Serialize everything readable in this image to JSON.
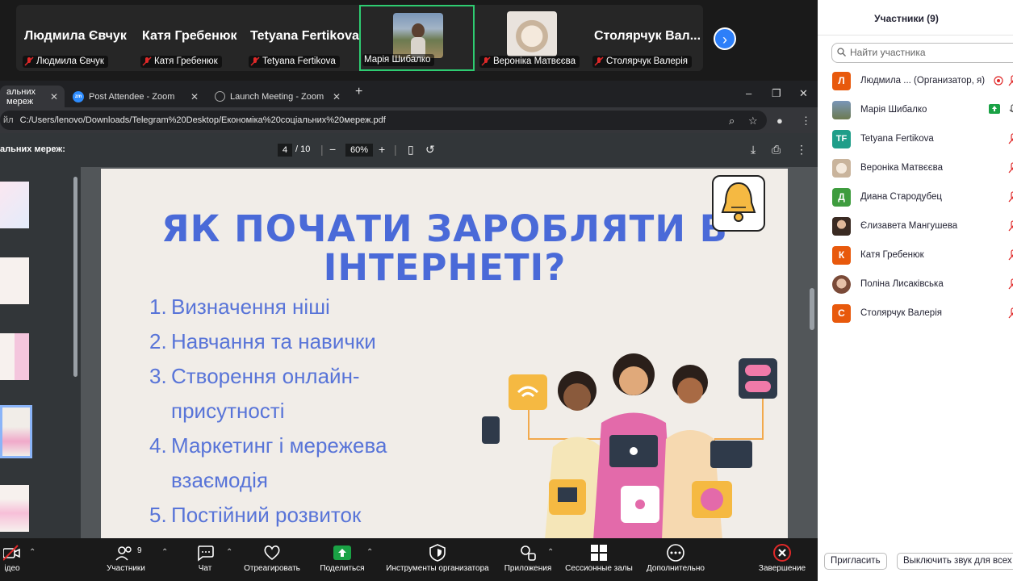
{
  "video_strip": {
    "tiles": [
      {
        "big_name": "Людмила Євчук",
        "small_name": "Людмила Євчук"
      },
      {
        "big_name": "Катя Гребенюк",
        "small_name": "Катя Гребенюк"
      },
      {
        "big_name": "Tetyana Fertikova",
        "small_name": "Tetyana Fertikova"
      },
      {
        "small_name": "Марія Шибалко"
      },
      {
        "small_name": "Вероніка Матвєєва"
      },
      {
        "big_name": "Столярчук Вал...",
        "small_name": "Столярчук Валерія"
      }
    ]
  },
  "browser": {
    "tabs": [
      {
        "label": "альних мереж"
      },
      {
        "label": "Post Attendee - Zoom"
      },
      {
        "label": "Launch Meeting - Zoom"
      }
    ],
    "url_prefix": "йл",
    "url": "C:/Users/lenovo/Downloads/Telegram%20Desktop/Економіка%20соціальних%20мереж.pdf",
    "pdf_title": "альних мереж:",
    "page_current": "4",
    "page_total": "/ 10",
    "zoom": "60%"
  },
  "slide": {
    "title_line1": "ЯК ПОЧАТИ ЗАРОБЛЯТИ В",
    "title_line2": "ІНТЕРНЕТІ?",
    "items": [
      {
        "num": "1.",
        "lines": [
          "Визначення ніші"
        ]
      },
      {
        "num": "2.",
        "lines": [
          "Навчання та навички"
        ]
      },
      {
        "num": "3.",
        "lines": [
          "Створення онлайн-",
          "присутності"
        ]
      },
      {
        "num": "4.",
        "lines": [
          "Маркетинг і мережева",
          "взаємодія"
        ]
      },
      {
        "num": "5.",
        "lines": [
          "Постійний розвиток"
        ]
      }
    ]
  },
  "toolbar": {
    "video": "ідео",
    "participants": "Участники",
    "participants_count": "9",
    "chat": "Чат",
    "react": "Отреагировать",
    "share": "Поделиться",
    "host_tools": "Инструменты организатора",
    "apps": "Приложения",
    "breakout": "Сессионные залы",
    "more": "Дополнительно",
    "end": "Завершение"
  },
  "panel": {
    "title": "Участники (9)",
    "search_placeholder": "Найти участника",
    "participants": [
      {
        "initial": "Л",
        "color": "#e8590c",
        "name": "Людмила ...  (Организатор, я)"
      },
      {
        "initial": "",
        "color": "#7a8a5a",
        "name": "Марія Шибалко"
      },
      {
        "initial": "TF",
        "color": "#1f9e89",
        "name": "Tetyana Fertikova"
      },
      {
        "initial": "",
        "color": "#c9b49c",
        "name": "Вероніка Матвєєва"
      },
      {
        "initial": "Д",
        "color": "#3e9c3e",
        "name": "Диана Стародубец"
      },
      {
        "initial": "",
        "color": "#6b5a4e",
        "name": "Єлизавета Мангушева"
      },
      {
        "initial": "К",
        "color": "#e8590c",
        "name": "Катя Гребенюк"
      },
      {
        "initial": "",
        "color": "#b88a78",
        "name": "Поліна Лисаківська"
      },
      {
        "initial": "С",
        "color": "#e8590c",
        "name": "Столярчук Валерія"
      }
    ],
    "invite": "Пригласить",
    "mute_all": "Выключить звук для всех"
  }
}
